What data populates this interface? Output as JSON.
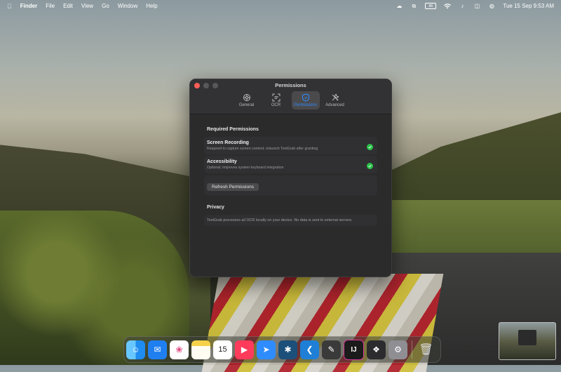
{
  "menubar": {
    "app_name": "Finder",
    "menus": [
      "File",
      "Edit",
      "View",
      "Go",
      "Window",
      "Help"
    ],
    "battery_label": "86",
    "datetime": "Tue 15 Sep  9:53 AM"
  },
  "window": {
    "title": "Permissions",
    "tabs": [
      {
        "label": "General",
        "icon": "gear-icon",
        "active": false
      },
      {
        "label": "OCR",
        "icon": "scan-icon",
        "active": false
      },
      {
        "label": "Permissions",
        "icon": "shield-icon",
        "active": true
      },
      {
        "label": "Advanced",
        "icon": "tools-icon",
        "active": false
      }
    ],
    "required_title": "Required Permissions",
    "permissions": [
      {
        "title": "Screen Recording",
        "subtitle": "Required to capture screen content; relaunch TextGrab after granting",
        "granted": true
      },
      {
        "title": "Accessibility",
        "subtitle": "Optional; improves system keyboard integration",
        "granted": true
      }
    ],
    "refresh_label": "Refresh Permissions",
    "privacy_title": "Privacy",
    "privacy_text": "TextGrab processes all OCR locally on your device. No data is sent to external servers."
  },
  "dock": {
    "apps": [
      {
        "name": "finder",
        "color": "#1e8cf0"
      },
      {
        "name": "mail",
        "color": "#1f7ff0"
      },
      {
        "name": "photos",
        "color": "#ffffff"
      },
      {
        "name": "notes",
        "color": "#f6e58d"
      },
      {
        "name": "calendar",
        "color": "#ffffff",
        "label": "15"
      },
      {
        "name": "music",
        "color": "#ff3b5c"
      },
      {
        "name": "safari",
        "color": "#2f8cff"
      },
      {
        "name": "perplexity",
        "color": "#1c4f7a"
      },
      {
        "name": "vscode",
        "color": "#1f7fd6"
      },
      {
        "name": "texteditor",
        "color": "#3a3a3a"
      },
      {
        "name": "intellij",
        "color": "#1b1b1b",
        "label": "IJ"
      },
      {
        "name": "chatgpt",
        "color": "#2c2c2e"
      },
      {
        "name": "settings",
        "color": "#8e8e93"
      },
      {
        "name": "trash",
        "color": "transparent"
      }
    ]
  },
  "colors": {
    "accent": "#2f8cff",
    "granted": "#2bc34a",
    "window_bg": "#2b2b2c"
  }
}
